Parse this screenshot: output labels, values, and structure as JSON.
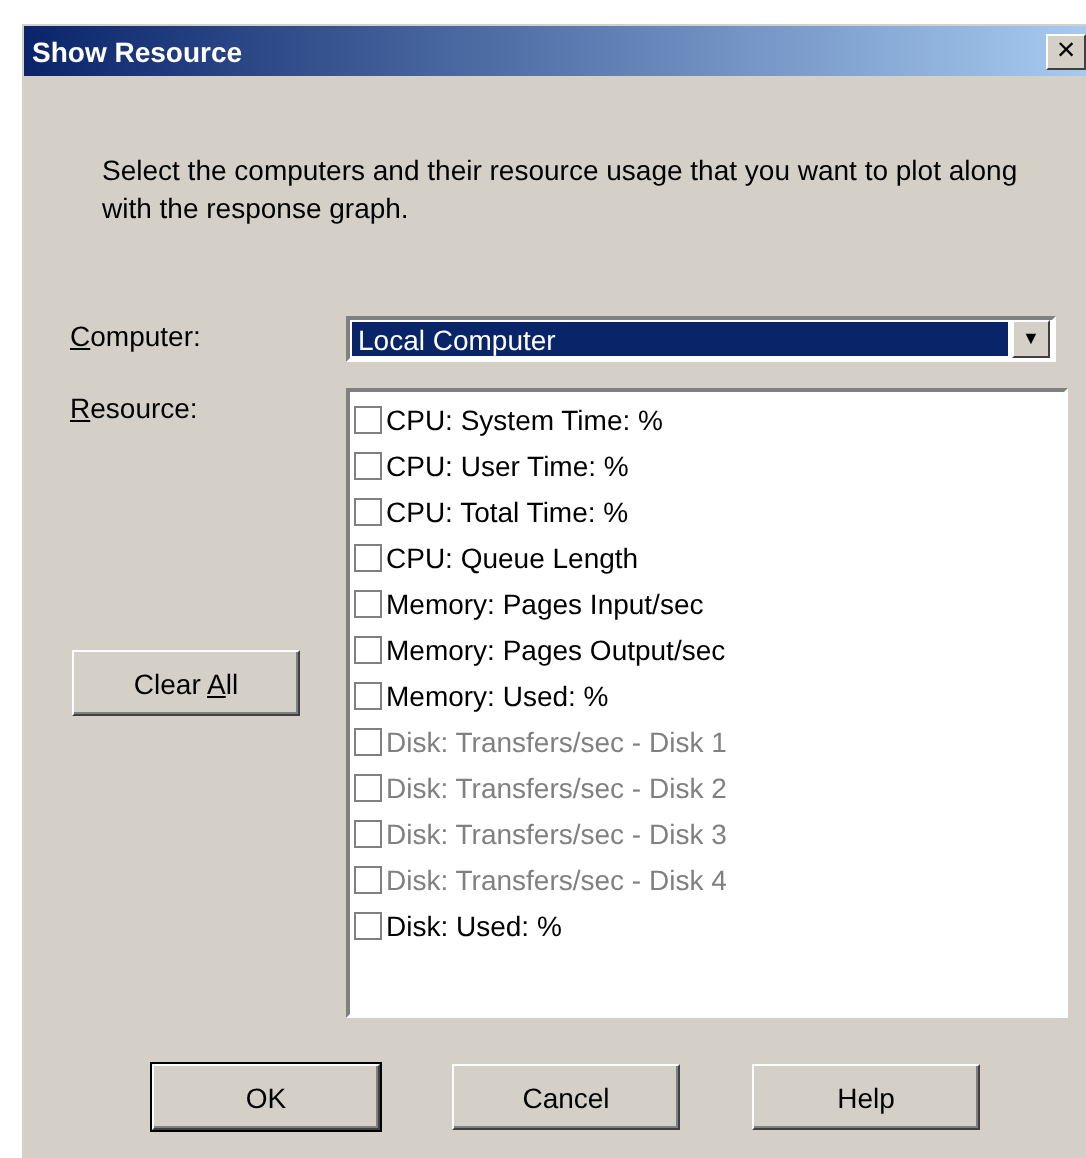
{
  "window": {
    "title": "Show Resource",
    "close": "×"
  },
  "description": "Select the computers and their resource usage that you want to plot along with the response graph.",
  "computer": {
    "label": {
      "mnemonic": "C",
      "rest": "omputer:"
    },
    "value": "Local Computer",
    "caret": "▼"
  },
  "resource": {
    "label": {
      "mnemonic": "R",
      "rest": "esource:"
    },
    "items": [
      {
        "label": "CPU: System Time: %",
        "checked": false,
        "disabled": false
      },
      {
        "label": "CPU: User Time: %",
        "checked": false,
        "disabled": false
      },
      {
        "label": "CPU: Total Time: %",
        "checked": false,
        "disabled": false
      },
      {
        "label": "CPU: Queue Length",
        "checked": false,
        "disabled": false
      },
      {
        "label": "Memory: Pages Input/sec",
        "checked": false,
        "disabled": false
      },
      {
        "label": "Memory: Pages Output/sec",
        "checked": false,
        "disabled": false
      },
      {
        "label": "Memory: Used: %",
        "checked": false,
        "disabled": false
      },
      {
        "label": "Disk: Transfers/sec - Disk 1",
        "checked": false,
        "disabled": true
      },
      {
        "label": "Disk: Transfers/sec - Disk 2",
        "checked": false,
        "disabled": true
      },
      {
        "label": "Disk: Transfers/sec - Disk 3",
        "checked": false,
        "disabled": true
      },
      {
        "label": "Disk: Transfers/sec - Disk 4",
        "checked": false,
        "disabled": true
      },
      {
        "label": "Disk: Used: %",
        "checked": false,
        "disabled": false
      }
    ]
  },
  "clear_button": {
    "before": "Clear ",
    "mnemonic": "A",
    "rest": "ll"
  },
  "buttons": [
    {
      "label": "OK",
      "default": true
    },
    {
      "label": "Cancel",
      "default": false
    },
    {
      "label": "Help",
      "default": false
    }
  ]
}
